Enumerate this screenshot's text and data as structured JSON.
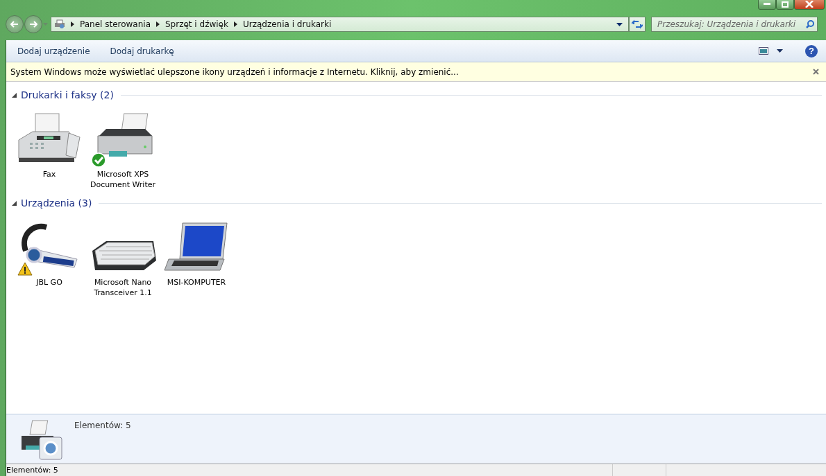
{
  "address_bar": {
    "breadcrumbs": [
      "Panel sterowania",
      "Sprzęt i dźwięk",
      "Urządzenia i drukarki"
    ]
  },
  "search": {
    "placeholder": "Przeszukaj: Urządzenia i drukarki"
  },
  "toolbar": {
    "buttons": [
      "Dodaj urządzenie",
      "Dodaj drukarkę"
    ],
    "help": "?"
  },
  "info_bar": {
    "text": "System Windows może wyświetlać ulepszone ikony urządzeń i informacje z Internetu. Kliknij, aby zmienić..."
  },
  "groups": [
    {
      "title": "Drukarki i faksy (2)",
      "expanded": true,
      "items": [
        {
          "label": "Fax",
          "kind": "fax",
          "default": false,
          "warning": false
        },
        {
          "label": "Microsoft XPS Document Writer",
          "kind": "printer",
          "default": true,
          "warning": false
        }
      ]
    },
    {
      "title": "Urządzenia (3)",
      "expanded": true,
      "items": [
        {
          "label": "JBL GO",
          "kind": "headset",
          "default": false,
          "warning": true
        },
        {
          "label": "Microsoft Nano Transceiver 1.1",
          "kind": "keyboard",
          "default": false,
          "warning": false
        },
        {
          "label": "MSI-KOMPUTER",
          "kind": "laptop",
          "default": false,
          "warning": false
        }
      ]
    }
  ],
  "details_pane": {
    "text": "Elementów: 5"
  },
  "status_bar": {
    "text": "Elementów: 5"
  }
}
